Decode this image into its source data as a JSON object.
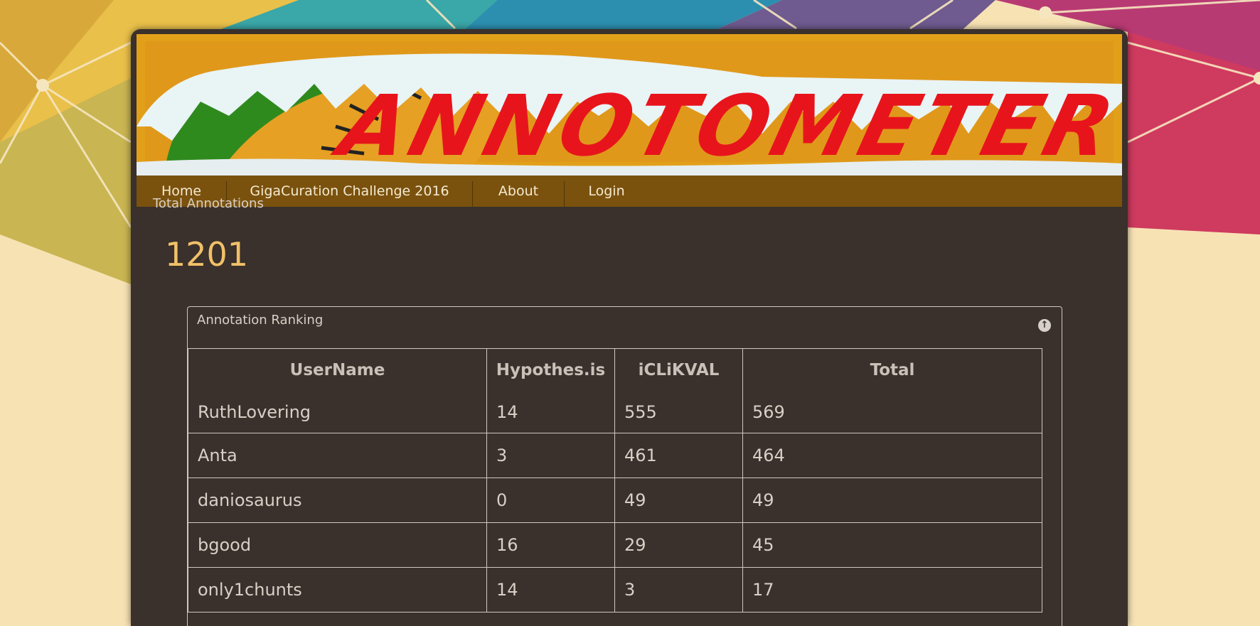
{
  "site": {
    "banner_title": "ANNOTOMETER",
    "colors": {
      "frame": "#3a302c",
      "nav": "#7a520e",
      "accent": "#f1c168",
      "banner_bg": "#e2a01a",
      "banner_text": "#e8141c"
    }
  },
  "nav": {
    "items": [
      {
        "label": "Home"
      },
      {
        "label": "GigaCuration Challenge 2016"
      },
      {
        "label": "About"
      },
      {
        "label": "Login"
      }
    ]
  },
  "summary": {
    "label": "Total Annotations",
    "value": "1201"
  },
  "ranking": {
    "title": "Annotation Ranking",
    "toggle_icon": "circle-arrow-up-icon",
    "columns": [
      "UserName",
      "Hypothes.is",
      "iCLiKVAL",
      "Total"
    ],
    "rows": [
      [
        "RuthLovering",
        "14",
        "555",
        "569"
      ],
      [
        "Anta",
        "3",
        "461",
        "464"
      ],
      [
        "daniosaurus",
        "0",
        "49",
        "49"
      ],
      [
        "bgood",
        "16",
        "29",
        "45"
      ],
      [
        "only1chunts",
        "14",
        "3",
        "17"
      ]
    ]
  }
}
